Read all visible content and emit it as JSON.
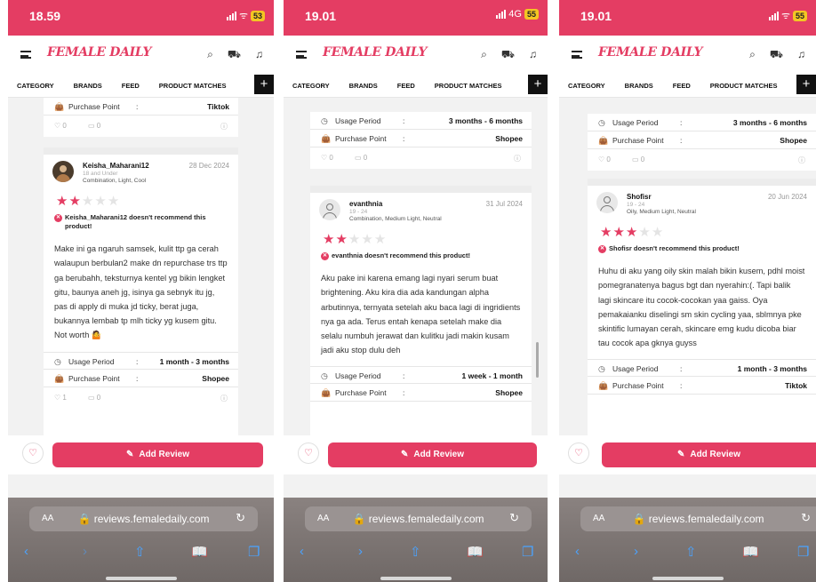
{
  "app": {
    "logo": "FEMALE DAILY",
    "tabs": [
      "CATEGORY",
      "BRANDS",
      "FEED",
      "PRODUCT MATCHES"
    ],
    "plus": "+",
    "add_review": "Add Review",
    "url": "reviews.femaledaily.com",
    "aa": "AA",
    "icons": {
      "search": "⌕",
      "cart": "⛟",
      "bell": "♫"
    }
  },
  "colors": {
    "brand": "#e43d63",
    "star_off": "#e4e4e4"
  },
  "phones": [
    {
      "time": "18.59",
      "network": "",
      "battery": "53",
      "prev_rows": [
        {
          "label": "Purchase Point",
          "value": "Tiktok"
        }
      ],
      "prev_reactions": {
        "likes": "0",
        "comments": "0"
      },
      "review": {
        "name": "Keisha_Maharani12",
        "age": "18 and Under",
        "skin": "Combination, Light, Cool",
        "date": "28 Dec 2024",
        "rating": 2,
        "not_recommend": "Keisha_Maharani12 doesn't recommend this product!",
        "text": "Make ini ga ngaruh samsek, kulit ttp ga cerah walaupun berbulan2 make dn repurchase trs ttp ga berubahh, teksturnya kentel yg bikin lengket gitu, baunya aneh jg, isinya ga sebnyk itu jg, pas di apply di muka jd ticky, berat juga, bukannya lembab tp mlh ticky yg kusem gitu. Not worth 🤷",
        "usage_period": "1 month - 3 months",
        "purchase_point": "Shopee",
        "likes": "1",
        "comments": "0"
      }
    },
    {
      "time": "19.01",
      "network": "4G",
      "battery": "55",
      "prev_rows": [
        {
          "label": "Usage Period",
          "value": "3 months - 6 months"
        },
        {
          "label": "Purchase Point",
          "value": "Shopee"
        }
      ],
      "prev_reactions": {
        "likes": "0",
        "comments": "0"
      },
      "review": {
        "name": "evanthnia",
        "age": "19 - 24",
        "skin": "Combination, Medium Light, Neutral",
        "date": "31 Jul 2024",
        "rating": 2,
        "not_recommend": "evanthnia doesn't recommend this product!",
        "text": "Aku pake ini karena emang lagi nyari serum buat brightening. Aku kira dia ada kandungan alpha arbutinnya, ternyata setelah aku baca lagi di ingridients nya ga ada. Terus entah kenapa setelah make dia selalu numbuh jerawat dan kulitku jadi makin kusam jadi aku stop dulu deh",
        "usage_period": "1 week - 1 month",
        "purchase_point": "Shopee"
      }
    },
    {
      "time": "19.01",
      "network": "",
      "battery": "55",
      "prev_rows": [
        {
          "label": "Usage Period",
          "value": "3 months - 6 months"
        },
        {
          "label": "Purchase Point",
          "value": "Shopee"
        }
      ],
      "prev_reactions": {
        "likes": "0",
        "comments": "0"
      },
      "review": {
        "name": "Shofisr",
        "age": "19 - 24",
        "skin": "Oily, Medium Light, Neutral",
        "date": "20 Jun 2024",
        "rating": 3,
        "not_recommend": "Shofisr doesn't recommend this product!",
        "text": "Huhu di aku yang oily skin malah bikin kusem, pdhl moist pomegranatenya bagus bgt dan nyerahin:(. Tapi balik lagi skincare itu cocok-cocokan yaa gaiss. Oya pemakaianku diselingi sm skin cycling yaa, sblmnya pke skintific lumayan cerah, skincare emg kudu dicoba biar tau cocok apa gknya guyss",
        "usage_period": "1 month - 3 months",
        "purchase_point": "Tiktok"
      }
    }
  ],
  "labels": {
    "usage_period": "Usage Period",
    "purchase_point": "Purchase Point",
    "colon": ":"
  }
}
